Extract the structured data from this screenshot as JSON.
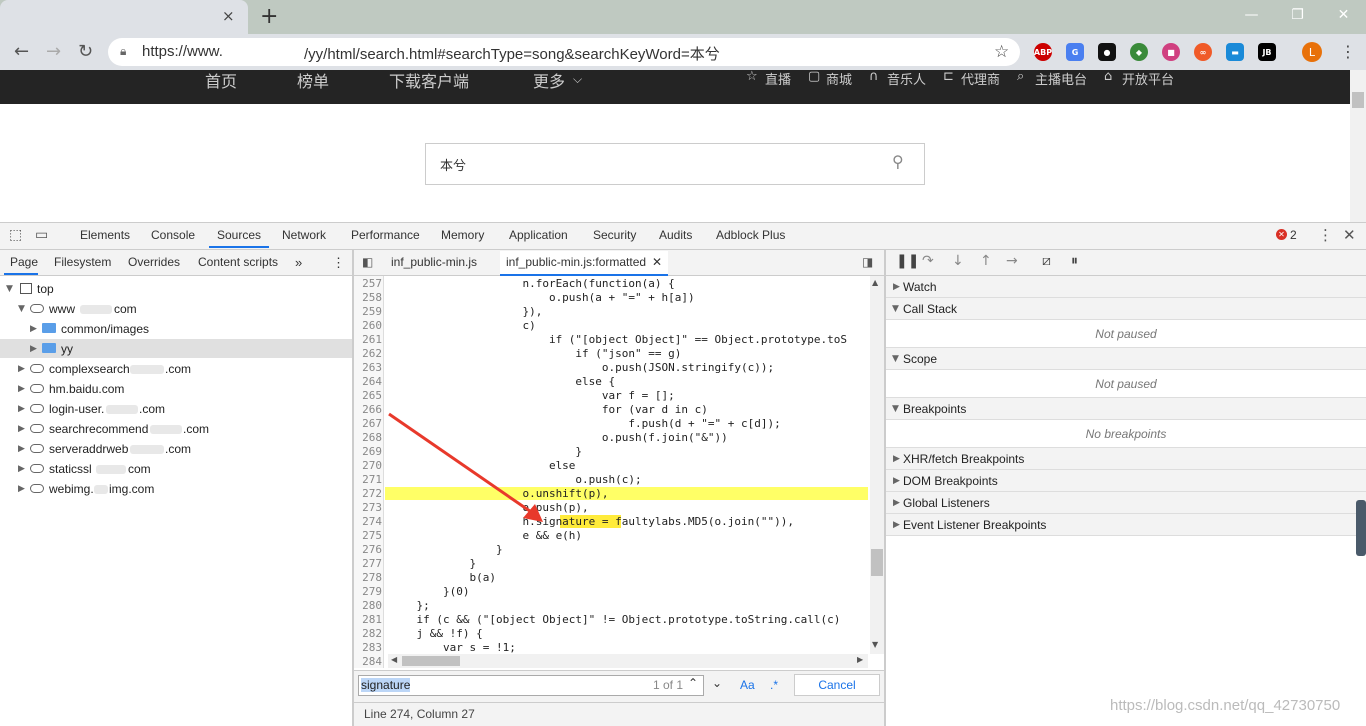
{
  "browser": {
    "new_tab": "+",
    "tab_close": "×",
    "url_part1": "https://www.",
    "url_part2": "/yy/html/search.html#searchType=song&searchKeyWord=本兮",
    "window_buttons": [
      "—",
      "❐",
      "✕"
    ],
    "extensions": [
      "ABP",
      "G",
      "●",
      "◆",
      "■",
      "∞",
      "▬",
      "JB"
    ],
    "profile_initial": "L"
  },
  "site": {
    "nav": [
      "首页",
      "榜单",
      "下载客户端",
      "更多"
    ],
    "nav_right": [
      "直播",
      "商城",
      "音乐人",
      "代理商",
      "主播电台",
      "开放平台"
    ],
    "search_value": "本兮"
  },
  "devtools": {
    "tabs": [
      "Elements",
      "Console",
      "Sources",
      "Network",
      "Performance",
      "Memory",
      "Application",
      "Security",
      "Audits",
      "Adblock Plus"
    ],
    "active_tab": "Sources",
    "error_count": "2",
    "navigator_tabs": [
      "Page",
      "Filesystem",
      "Overrides",
      "Content scripts"
    ],
    "tree": {
      "top": "top",
      "www": "www",
      "www_suffix": "com",
      "common": "common/images",
      "yy": "yy",
      "complex": "complexsearch",
      "complex_suffix": ".com",
      "hm": "hm.baidu.com",
      "login": "login-user.",
      "login_suffix": ".com",
      "searchrec": "searchrecommend",
      "searchrec_suffix": ".com",
      "serveraddr": "serveraddrweb",
      "serveraddr_suffix": ".com",
      "staticssl": "staticssl",
      "staticssl_suffix": "com",
      "webimg": "webimg.",
      "webimg_suffix": "img.com"
    },
    "editor_tabs": [
      "inf_public-min.js",
      "inf_public-min.js:formatted"
    ],
    "code_lines": [
      {
        "n": "257",
        "t": "                    n.forEach(function(a) {"
      },
      {
        "n": "258",
        "t": "                        o.push(a + \"=\" + h[a])"
      },
      {
        "n": "259",
        "t": "                    }),"
      },
      {
        "n": "260",
        "t": "                    c)"
      },
      {
        "n": "261",
        "t": "                        if (\"[object Object]\" == Object.prototype.toS"
      },
      {
        "n": "262",
        "t": "                            if (\"json\" == g)"
      },
      {
        "n": "263",
        "t": "                                o.push(JSON.stringify(c));"
      },
      {
        "n": "264",
        "t": "                            else {"
      },
      {
        "n": "265",
        "t": "                                var f = [];"
      },
      {
        "n": "266",
        "t": "                                for (var d in c)"
      },
      {
        "n": "267",
        "t": "                                    f.push(d + \"=\" + c[d]);"
      },
      {
        "n": "268",
        "t": "                                o.push(f.join(\"&\"))"
      },
      {
        "n": "269",
        "t": "                            }"
      },
      {
        "n": "270",
        "t": "                        else"
      },
      {
        "n": "271",
        "t": "                            o.push(c);"
      },
      {
        "n": "272",
        "t": "                    o.unshift(p),"
      },
      {
        "n": "273",
        "t": "                    o.push(p),"
      },
      {
        "n": "274",
        "t": "                    h.signature = faultylabs.MD5(o.join(\"\")),"
      },
      {
        "n": "275",
        "t": "                    e && e(h)"
      },
      {
        "n": "276",
        "t": "                }"
      },
      {
        "n": "277",
        "t": "            }"
      },
      {
        "n": "278",
        "t": "            b(a)"
      },
      {
        "n": "279",
        "t": "        }(0)"
      },
      {
        "n": "280",
        "t": "    };"
      },
      {
        "n": "281",
        "t": "    if (c && (\"[object Object]\" != Object.prototype.toString.call(c)"
      },
      {
        "n": "282",
        "t": "    j && !f) {"
      },
      {
        "n": "283",
        "t": "        var s = !1;"
      },
      {
        "n": "284",
        "t": "        "
      }
    ],
    "find": {
      "query": "signature",
      "count": "1 of 1",
      "case": "Aa",
      "regex": ".*",
      "cancel": "Cancel"
    },
    "status": "Line 274, Column 27",
    "sections": {
      "watch": "Watch",
      "callstack": "Call Stack",
      "callstack_empty": "Not paused",
      "scope": "Scope",
      "scope_empty": "Not paused",
      "breakpoints": "Breakpoints",
      "breakpoints_empty": "No breakpoints",
      "xhr": "XHR/fetch Breakpoints",
      "dom": "DOM Breakpoints",
      "global": "Global Listeners",
      "event": "Event Listener Breakpoints"
    }
  },
  "watermark": "https://blog.csdn.net/qq_42730750"
}
